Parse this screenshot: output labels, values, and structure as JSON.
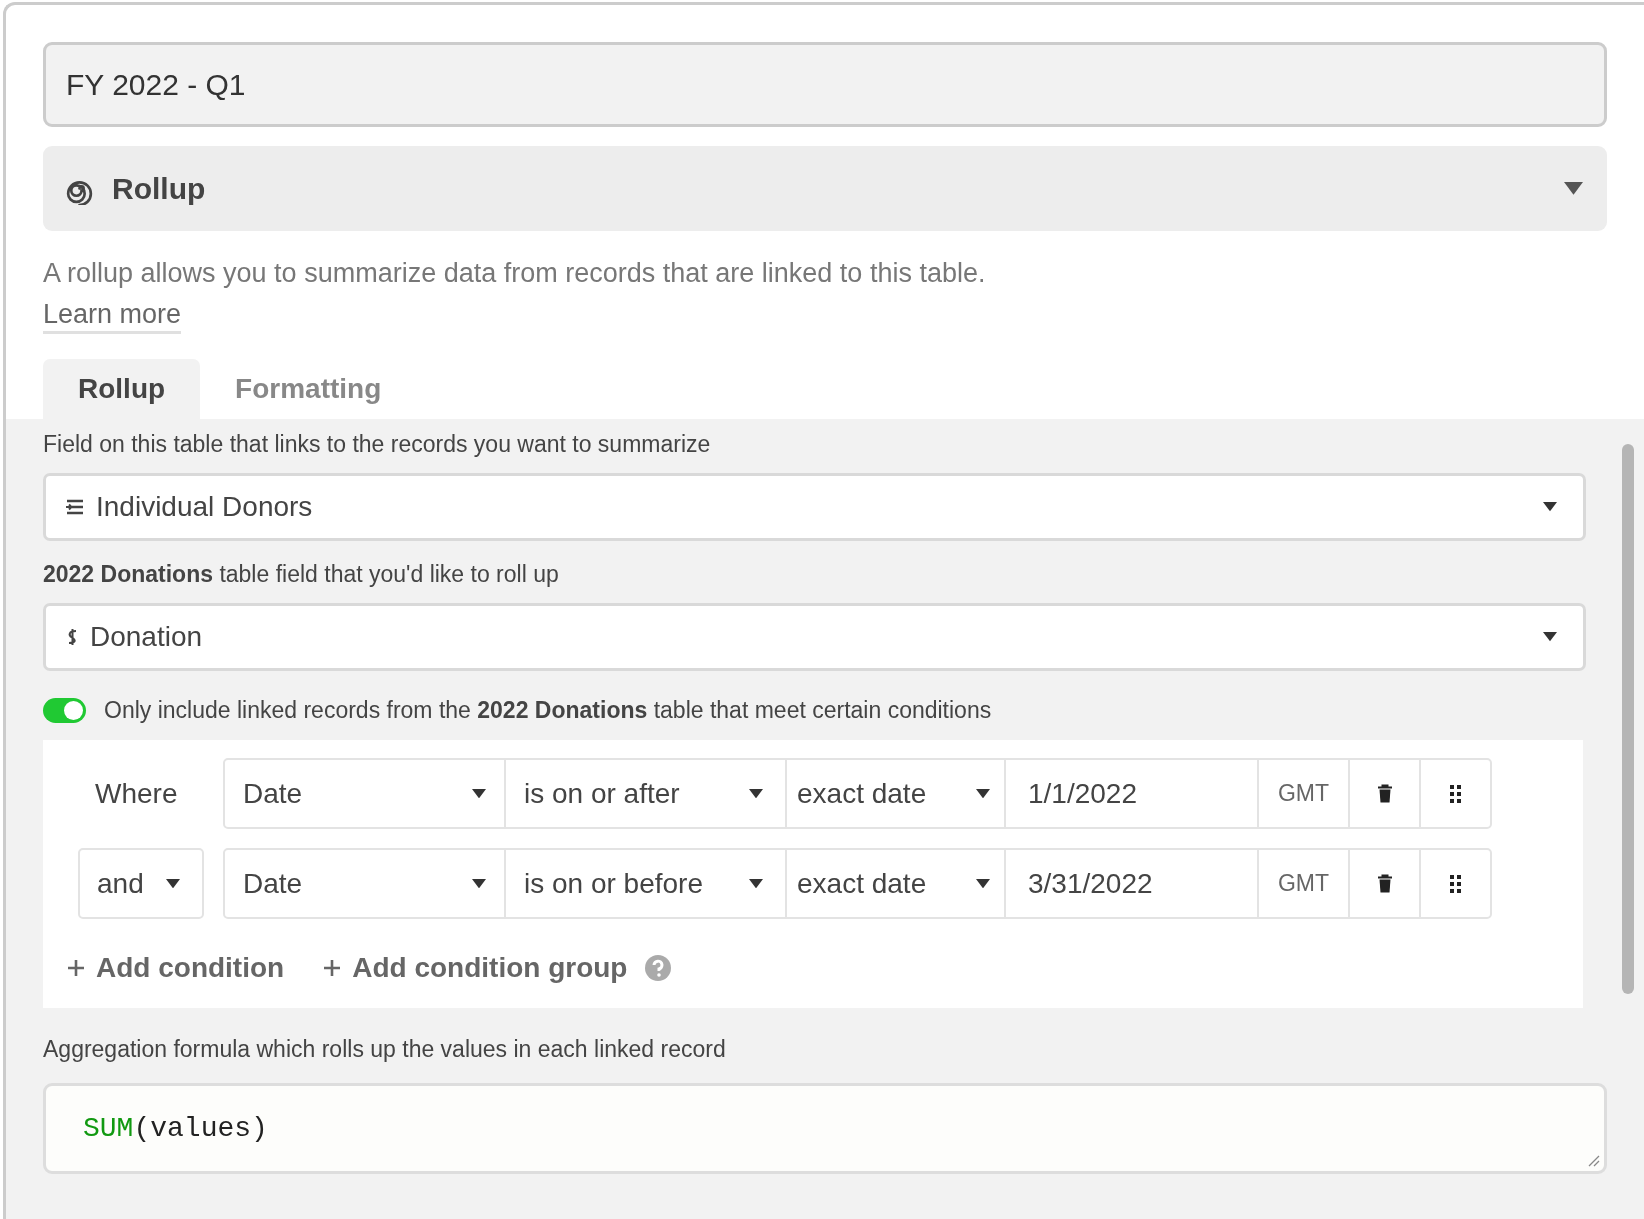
{
  "name_field": {
    "value": "FY 2022 - Q1"
  },
  "field_type": {
    "label": "Rollup"
  },
  "description": {
    "text": "A rollup allows you to summarize data from records that are linked to this table.",
    "link": "Learn more"
  },
  "tabs": [
    {
      "label": "Rollup",
      "selected": true
    },
    {
      "label": "Formatting",
      "selected": false
    }
  ],
  "link_field": {
    "label": "Field on this table that links to the records you want to summarize",
    "value": "Individual Donors"
  },
  "rollup_field": {
    "label": "**2022 Donations** table field that you'd like to roll up",
    "value": "Donation"
  },
  "condition_toggle": {
    "on": true,
    "label": "Only include linked records from the **2022 Donations** table that meet certain conditions"
  },
  "conditions": [
    {
      "conjunction": {
        "kind": "text",
        "text": "Where"
      },
      "field": "Date",
      "operator": "is on or after",
      "mode": "exact date",
      "value": "1/1/2022",
      "timezone": "GMT"
    },
    {
      "conjunction": {
        "kind": "dropdown",
        "text": "and"
      },
      "field": "Date",
      "operator": "is on or before",
      "mode": "exact date",
      "value": "3/31/2022",
      "timezone": "GMT"
    }
  ],
  "actions": [
    {
      "kind": "add",
      "label": "Add condition"
    },
    {
      "kind": "add_help",
      "label": "Add condition group"
    }
  ],
  "formula": {
    "label": "Aggregation formula which rolls up the values in each linked record",
    "tokens": [
      {
        "kind": "function",
        "text": "SUM"
      },
      {
        "kind": "plain",
        "text": "(values)"
      }
    ]
  }
}
